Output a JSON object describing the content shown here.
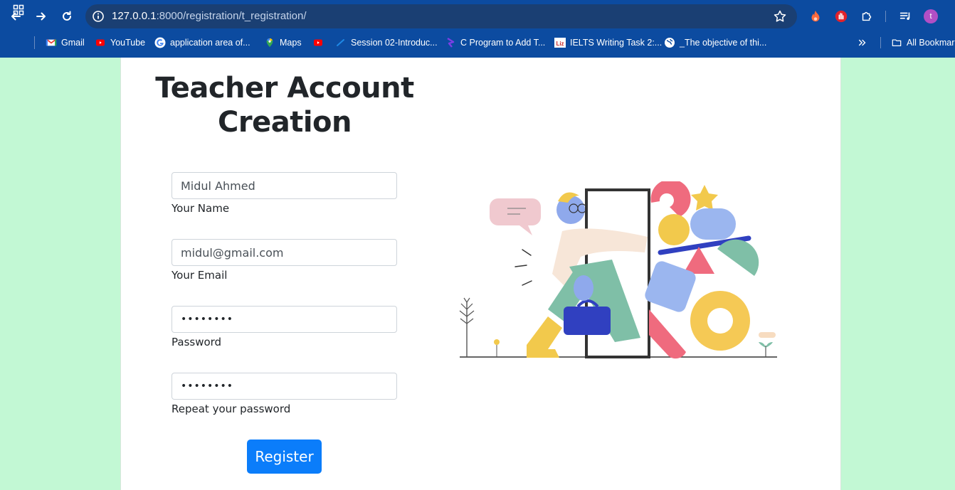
{
  "browser": {
    "url_host": "127.0.0.1",
    "url_rest": ":8000/registration/t_registration/",
    "profile_initial": "t",
    "bookmarks": [
      {
        "label": "Gmail",
        "icon": "gmail-icon"
      },
      {
        "label": "YouTube",
        "icon": "youtube-icon"
      },
      {
        "label": "application area of...",
        "icon": "google-icon"
      },
      {
        "label": "Maps",
        "icon": "maps-icon"
      },
      {
        "label": "",
        "icon": "youtube-icon"
      },
      {
        "label": "Session 02-Introduc...",
        "icon": "link-icon"
      },
      {
        "label": "C Program to Add T...",
        "icon": "c-program-icon"
      },
      {
        "label": "IELTS Writing Task 2:...",
        "icon": "liz-icon"
      },
      {
        "label": "_The objective of thi...",
        "icon": "globe-icon"
      }
    ],
    "all_bookmarks": "All Bookmarks",
    "colors": {
      "chrome": "#0c4ba0",
      "urlbar": "#1a3f73"
    }
  },
  "page": {
    "title": "Teacher Account Creation",
    "fields": [
      {
        "value": "Midul Ahmed",
        "label": "Your Name"
      },
      {
        "value": "midul@gmail.com",
        "label": "Your Email"
      },
      {
        "value": "••••••••",
        "label": "Password"
      },
      {
        "value": "••••••••",
        "label": "Repeat your password"
      }
    ],
    "register_label": "Register",
    "colors": {
      "background": "#c2f8d4",
      "button": "#0b7dfa"
    }
  }
}
